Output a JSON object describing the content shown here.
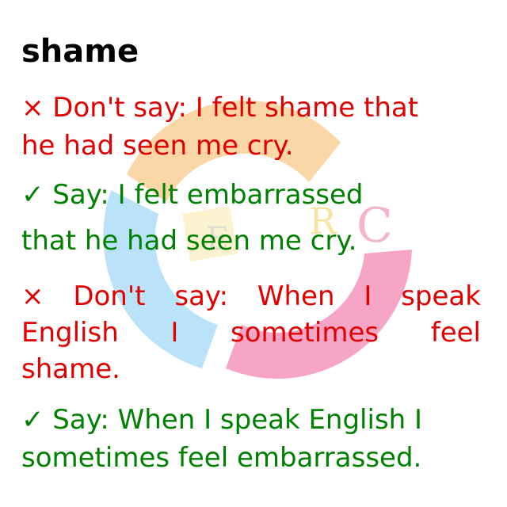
{
  "headword": "shame",
  "colors": {
    "wrong": "#e00000",
    "right": "#008000",
    "headword": "#000000",
    "watermark_orange": "#f9c98a",
    "watermark_blue": "#a9dcf7",
    "watermark_pink": "#f58fb8",
    "watermark_yellow": "#f7e7a8"
  },
  "watermark": {
    "letters": [
      "R",
      "E",
      "C"
    ],
    "icon": "circular-logo-watermark"
  },
  "examples": [
    {
      "type": "wrong",
      "marker": "×",
      "lines": [
        "× Don't say: I felt shame that",
        "he had seen me cry."
      ]
    },
    {
      "type": "right",
      "marker": "✓",
      "lines": [
        "✓ Say: I felt embarrassed",
        "that he had seen me cry."
      ]
    },
    {
      "type": "wrong",
      "marker": "×",
      "lines_words": [
        [
          "×",
          "Don't",
          "say:",
          "When",
          "I",
          "speak"
        ],
        [
          "English",
          "I",
          "sometimes",
          "feel"
        ]
      ],
      "last_line": "shame."
    },
    {
      "type": "right",
      "marker": "✓",
      "lines": [
        "✓ Say: When I speak English I",
        "sometimes feel embarrassed."
      ]
    }
  ]
}
